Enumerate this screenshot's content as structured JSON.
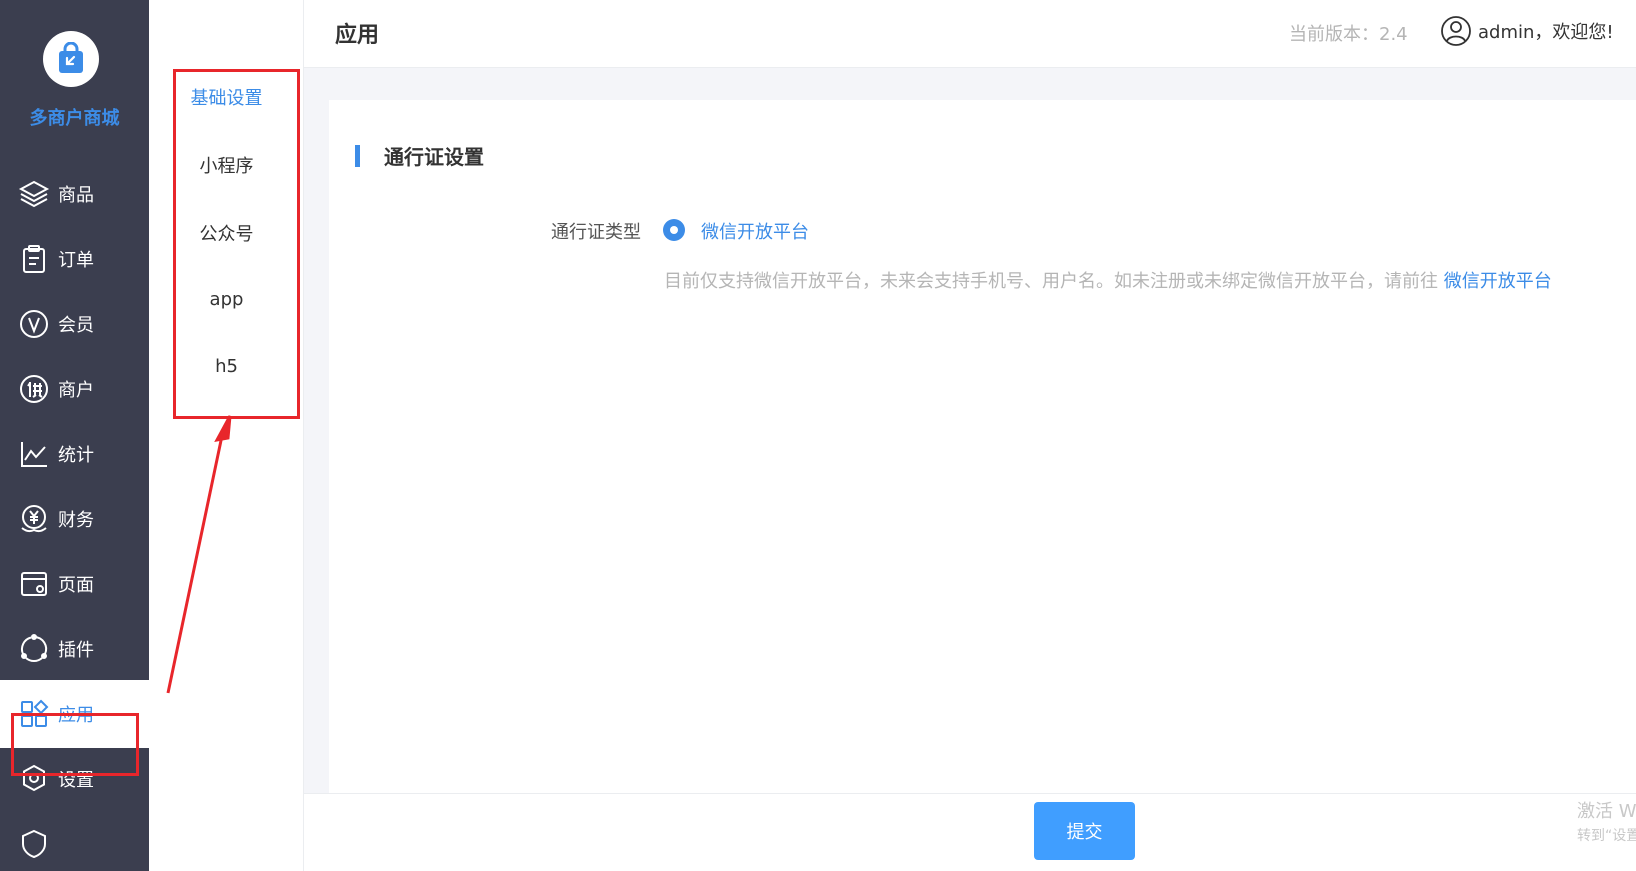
{
  "sidebar": {
    "brand": "多商户商城",
    "items": [
      {
        "label": "商品",
        "icon": "layers-icon"
      },
      {
        "label": "订单",
        "icon": "clipboard-icon"
      },
      {
        "label": "会员",
        "icon": "vip-icon"
      },
      {
        "label": "商户",
        "icon": "supplier-icon"
      },
      {
        "label": "统计",
        "icon": "chart-icon"
      },
      {
        "label": "财务",
        "icon": "finance-icon"
      },
      {
        "label": "页面",
        "icon": "page-icon"
      },
      {
        "label": "插件",
        "icon": "plugin-icon"
      },
      {
        "label": "应用",
        "icon": "apps-icon",
        "active": true
      },
      {
        "label": "设置",
        "icon": "gear-icon"
      }
    ]
  },
  "subnav": {
    "items": [
      {
        "label": "基础设置",
        "active": true
      },
      {
        "label": "小程序"
      },
      {
        "label": "公众号"
      },
      {
        "label": "app"
      },
      {
        "label": "h5"
      }
    ]
  },
  "header": {
    "title": "应用",
    "version": "当前版本：2.4",
    "user": "admin，欢迎您!"
  },
  "form": {
    "section_title": "通行证设置",
    "field_label": "通行证类型",
    "radio_option": "微信开放平台",
    "hint_text": "目前仅支持微信开放平台，未来会支持手机号、用户名。如未注册或未绑定微信开放平台，请前往",
    "hint_link": "微信开放平台"
  },
  "footer": {
    "submit_label": "提交",
    "watermark_line1": "激活 W",
    "watermark_line2": "转到“设置"
  },
  "colors": {
    "accent": "#3c8ce7",
    "sidebar_bg": "#3b3e4f",
    "annotation_red": "#e8262b"
  }
}
